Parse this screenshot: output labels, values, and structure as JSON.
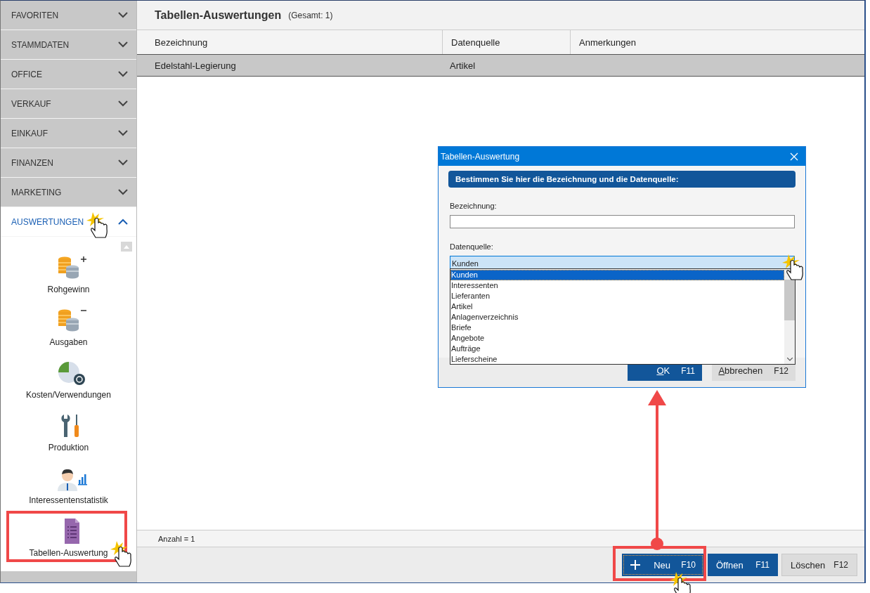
{
  "sidebar": {
    "sections": [
      {
        "label": "FAVORITEN",
        "expanded": false
      },
      {
        "label": "STAMMDATEN",
        "expanded": false
      },
      {
        "label": "OFFICE",
        "expanded": false
      },
      {
        "label": "VERKAUF",
        "expanded": false
      },
      {
        "label": "EINKAUF",
        "expanded": false
      },
      {
        "label": "FINANZEN",
        "expanded": false
      },
      {
        "label": "MARKETING",
        "expanded": false
      },
      {
        "label": "AUSWERTUNGEN",
        "expanded": true,
        "items": [
          {
            "label": "Rohgewinn"
          },
          {
            "label": "Ausgaben"
          },
          {
            "label": "Kosten/Verwendungen"
          },
          {
            "label": "Produktion"
          },
          {
            "label": "Interessentenstatistik"
          },
          {
            "label": "Tabellen-Auswertung"
          }
        ]
      }
    ]
  },
  "main": {
    "title": "Tabellen-Auswertungen",
    "count": "(Gesamt: 1)",
    "columns": [
      "Bezeichnung",
      "Datenquelle",
      "Anmerkungen"
    ],
    "rows": [
      {
        "bezeichnung": "Edelstahl-Legierung",
        "datenquelle": "Artikel",
        "selected": true
      }
    ],
    "footer": "Anzahl = 1",
    "buttons": [
      {
        "label": "Neu",
        "shortcut": "F10",
        "kind": "add",
        "focused": true
      },
      {
        "label": "Öffnen",
        "shortcut": "F11",
        "kind": "primary",
        "focused": false
      },
      {
        "label": "Löschen",
        "shortcut": "F12",
        "kind": "secondary",
        "focused": false
      }
    ]
  },
  "dialog": {
    "title": "Tabellen-Auswertung",
    "banner": "Bestimmen Sie hier die Bezeichnung und die Datenquelle:",
    "name_label": "Bezeichnung:",
    "source_label": "Datenquelle:",
    "source_value": "Kunden",
    "options": [
      {
        "label": "Kunden",
        "selected": true
      },
      {
        "label": "Interessenten",
        "selected": false
      },
      {
        "label": "Lieferanten",
        "selected": false
      },
      {
        "label": "Artikel",
        "selected": false
      },
      {
        "label": "Anlagenverzeichnis",
        "selected": false
      },
      {
        "label": "Briefe",
        "selected": false
      },
      {
        "label": "Angebote",
        "selected": false
      },
      {
        "label": "Aufträge",
        "selected": false
      },
      {
        "label": "Lieferscheine",
        "selected": false
      }
    ],
    "buttons": [
      {
        "label": "OK",
        "shortcut": "F11",
        "kind": "primary"
      },
      {
        "label": "Abbrechen",
        "shortcut": "F12",
        "kind": "secondary"
      }
    ]
  }
}
